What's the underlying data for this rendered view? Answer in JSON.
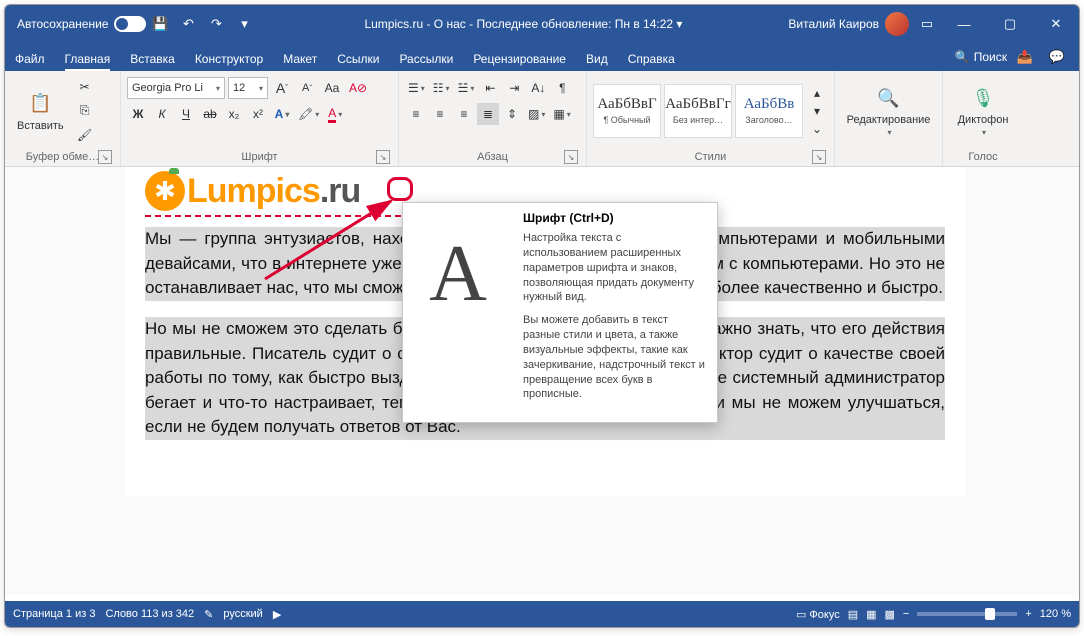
{
  "titlebar": {
    "autosave": "Автосохранение",
    "title": "Lumpics.ru - О нас - Последнее обновление: Пн в 14:22 ▾",
    "user": "Виталий Каиров"
  },
  "tabs": {
    "file": "Файл",
    "home": "Главная",
    "insert": "Вставка",
    "design": "Конструктор",
    "layout": "Макет",
    "references": "Ссылки",
    "mailings": "Рассылки",
    "review": "Рецензирование",
    "view": "Вид",
    "help": "Справка",
    "search": "Поиск"
  },
  "ribbon": {
    "clipboard": {
      "label": "Буфер обме…",
      "paste": "Вставить"
    },
    "font": {
      "label": "Шрифт",
      "name": "Georgia Pro Li",
      "size": "12",
      "bold": "Ж",
      "italic": "К",
      "underline": "Ч",
      "strike": "ab",
      "sub": "x₂",
      "sup": "x²",
      "bigA": "A",
      "smallA": "A",
      "caseAa": "Aa",
      "clear": "A",
      "effectA": "A",
      "highlight": "A",
      "color": "A"
    },
    "paragraph": {
      "label": "Абзац"
    },
    "styles": {
      "label": "Стили",
      "items": [
        {
          "prev": "АаБбВвГ",
          "name": "¶ Обычный"
        },
        {
          "prev": "АаБбВвГг",
          "name": "Без интер…"
        },
        {
          "prev": "АаБбВв",
          "name": "Заголово…"
        }
      ]
    },
    "editing": {
      "label": "Редактирование"
    },
    "voice": {
      "label": "Голос",
      "dictate": "Диктофон"
    }
  },
  "tooltip": {
    "title": "Шрифт (Ctrl+D)",
    "p1": "Настройка текста с использованием расширенных параметров шрифта и знаков, позволяющая придать документу нужный вид.",
    "p2": "Вы можете добавить в текст разные стили и цвета, а также визуальные эффекты, такие как зачеркивание, надстрочный текст и превращение всех букв в прописные."
  },
  "doc": {
    "logo1": "Lumpics",
    "logo2": ".ru",
    "p1": "Мы — группа энтузиастов, находящихся в ежедневном контакте с компьютерами и мобильными девайсами, что в интернете уже полно информации о решении проблем с компьютерами. Но это не останавливает нас, что мы сможем решить многие проблемы и задачи более качественно и быстро.",
    "p2": "Но мы не сможем это сделать без Вашей помощи. Любому человеку важно знать, что его действия правильные. Писатель судит о своей работе по отзывам читателей. Доктор судит о качестве своей работы по тому, как быстро выздоравливают его пациенты. Чем меньше системный администратор бегает и что-то настраивает, тем он качественнее делает работу. Так и мы не можем улучшаться, если не будем получать ответов от Вас."
  },
  "status": {
    "page": "Страница 1 из 3",
    "words": "Слово 113 из 342",
    "lang": "русский",
    "focus": "Фокус",
    "zoom": "120 %"
  }
}
